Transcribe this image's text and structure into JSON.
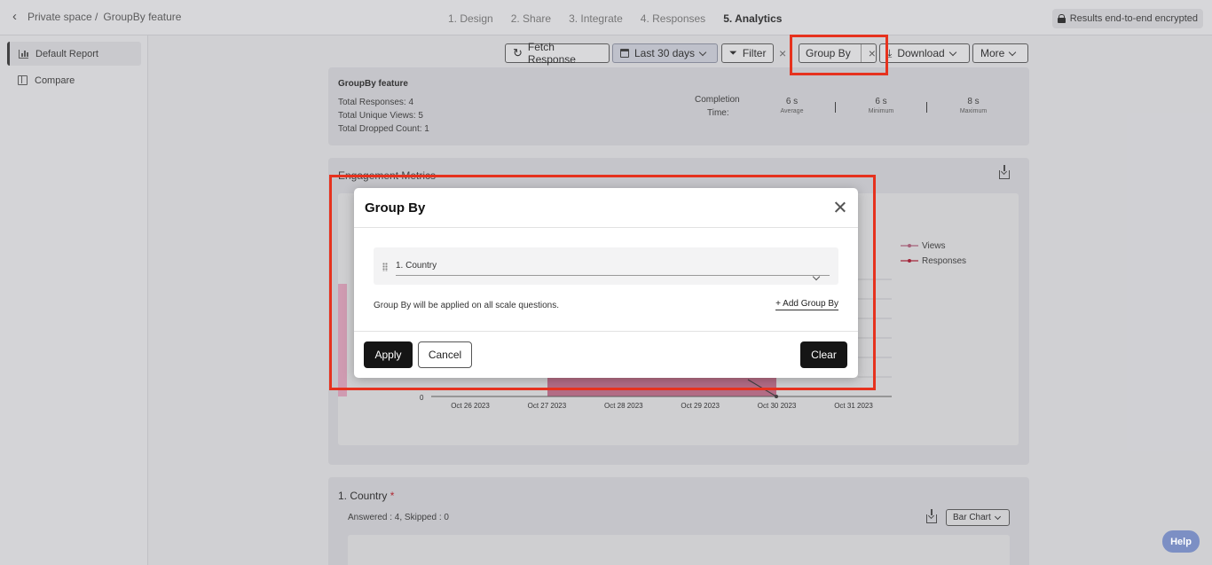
{
  "breadcrumb": {
    "space": "Private space /",
    "current": "GroupBy feature"
  },
  "steps": [
    "1. Design",
    "2. Share",
    "3. Integrate",
    "4. Responses",
    "5. Analytics"
  ],
  "encrypted_label": "Results end-to-end encrypted",
  "sidebar": {
    "items": [
      {
        "label": "Default Report"
      },
      {
        "label": "Compare"
      }
    ]
  },
  "toolbar": {
    "fetch": "Fetch Response",
    "date": "Last 30 days",
    "filter": "Filter",
    "groupby": "Group By",
    "download": "Download",
    "more": "More"
  },
  "summary": {
    "title": "GroupBy feature",
    "total_responses": "Total Responses: 4",
    "total_unique_views": "Total Unique Views: 5",
    "total_dropped": "Total Dropped Count: 1",
    "completion_label_1": "Completion",
    "completion_label_2": "Time:",
    "stats": [
      {
        "value": "6 s",
        "label": "Average"
      },
      {
        "value": "6 s",
        "label": "Minimum"
      },
      {
        "value": "8 s",
        "label": "Maximum"
      }
    ]
  },
  "engagement": {
    "title": "Engagement Metrics",
    "legend": [
      "Views",
      "Responses"
    ],
    "y_zero": "0"
  },
  "chart_data": {
    "type": "line",
    "title": "Engagement Metrics",
    "categories": [
      "Oct 26 2023",
      "Oct 27 2023",
      "Oct 28 2023",
      "Oct 29 2023",
      "Oct 30 2023",
      "Oct 31 2023"
    ],
    "series": [
      {
        "name": "Views"
      },
      {
        "name": "Responses"
      }
    ],
    "legend": "right"
  },
  "question": {
    "title": "1. Country",
    "required_mark": "*",
    "answered": "Answered : 4, Skipped : 0",
    "chart_type": "Bar Chart"
  },
  "modal": {
    "title": "Group By",
    "selected": "1. Country",
    "note": "Group By will be applied on all scale questions.",
    "add_link": "+ Add Group By",
    "apply": "Apply",
    "cancel": "Cancel",
    "clear": "Clear"
  },
  "help": "Help",
  "colors": {
    "views": "#b35a78",
    "responses": "#b0102a",
    "highlight": "#e6321e"
  }
}
